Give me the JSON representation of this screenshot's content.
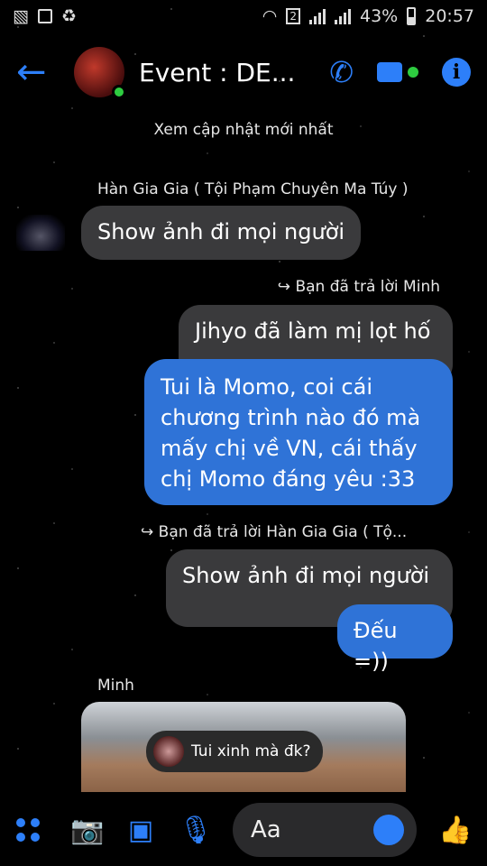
{
  "status_bar": {
    "signal_badge": "2",
    "battery": "43%",
    "time": "20:57"
  },
  "header": {
    "title": "Event : DE...",
    "back_icon": "back-arrow-icon",
    "call_icon": "phone-icon",
    "video_icon": "video-camera-icon",
    "info_icon": "info-icon",
    "accent": "#2d7ff9"
  },
  "chat": {
    "system_notice": "Xem cập nhật mới nhất",
    "sender1_label": "Hàn Gia Gia ( Tội Phạm Chuyên Ma Túy )",
    "msg1": "Show ảnh đi mọi người",
    "reply1_label": "Bạn đã trả lời Minh",
    "quoted1": "Jihyo đã làm mị lọt hố",
    "msg2": "Tui là Momo, coi cái chương trình nào đó mà mấy chị về VN, cái thấy chị Momo đáng yêu :33",
    "reply2_label": "Bạn đã trả lời Hàn Gia Gia ( Tộ...",
    "quoted2": "Show ảnh đi mọi người",
    "msg3": "Đếu =))",
    "sender2_label": "Minh",
    "photo_caption": "Tui xinh mà đk?"
  },
  "composer": {
    "placeholder": "Aa"
  }
}
